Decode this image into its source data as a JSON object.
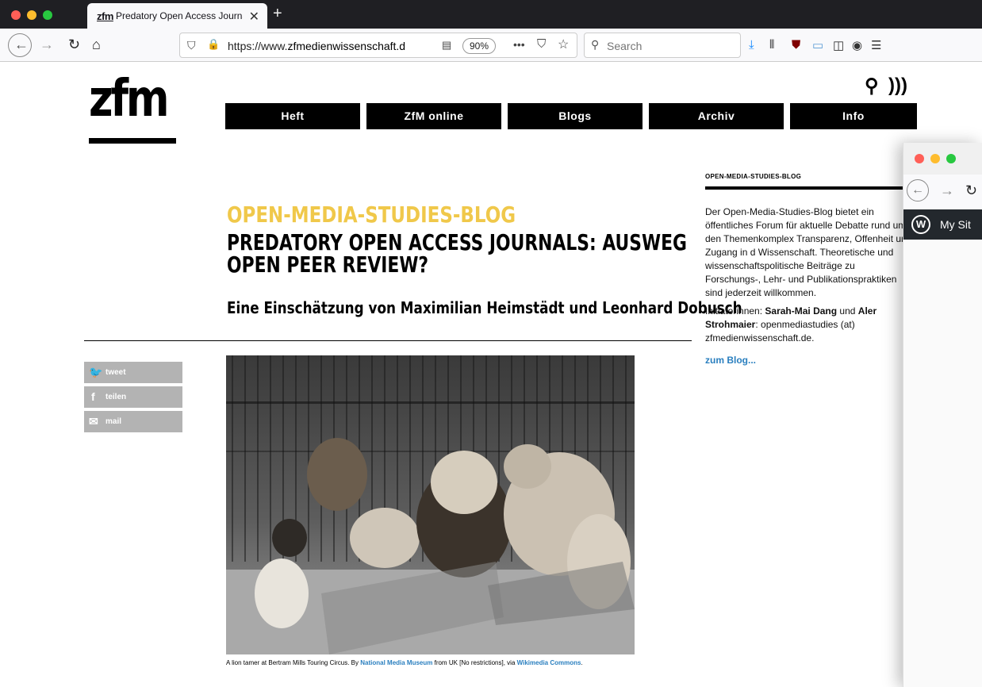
{
  "browser": {
    "tab_title": "Predatory Open Access Journa",
    "tab_icon_text": "zfm",
    "url_protocol": "https://www.",
    "url_domain": "zfmedienwissenschaft.d",
    "zoom": "90%",
    "search_placeholder": "Search",
    "window_dot_colors": [
      "#ff5f57",
      "#febc2e",
      "#28c840"
    ]
  },
  "site": {
    "logo_text": "zfm",
    "nav": [
      "Heft",
      "ZfM online",
      "Blogs",
      "Archiv",
      "Info"
    ]
  },
  "article": {
    "kicker": "OPEN-MEDIA-STUDIES-BLOG",
    "title_line1": "PREDATORY OPEN ACCESS JOURNALS: AUSWEG",
    "title_line2": "OPEN PEER REVIEW?",
    "subtitle": "Eine Einschätzung von Maximilian Heimstädt und Leonhard Dobusch",
    "share": [
      "tweet",
      "teilen",
      "mail"
    ],
    "caption_prefix": "A lion tamer at Bertram Mills Touring Circus. By ",
    "caption_link1": "National Media Museum",
    "caption_middle": " from UK [No restrictions], via ",
    "caption_link2": "Wikimedia Commons",
    "caption_end": "."
  },
  "sidebar": {
    "title": "OPEN-MEDIA-STUDIES-BLOG",
    "description": "Der Open-Media-Studies-Blog bietet ein öffentliches Forum für aktuelle Debatte rund um den Themenkomplex Transparenz, Offenheit und Zugang in d Wissenschaft. Theoretische und wissenschaftspolitische Beiträge zu Forschungs-, Lehr- und Publikationspraktiken sind jederzeit willkommen.",
    "initiators_label": "Initiatorinnen: ",
    "initiator1": "Sarah-Mai Dang",
    "and": " und ",
    "initiator2": "Aler",
    "initiator2_cont": "Strohmaier",
    "contact": ": openmediastudies (at) zfmedienwissenschaft.de.",
    "link": "zum Blog..."
  },
  "second_window": {
    "wp_label": "My Sit"
  }
}
